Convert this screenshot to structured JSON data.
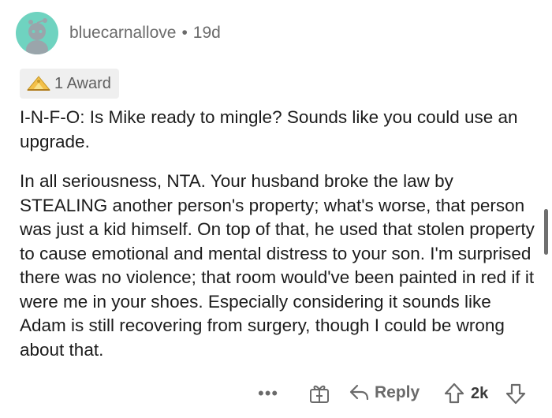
{
  "comment": {
    "username": "bluecarnallove",
    "separator": "•",
    "age": "19d",
    "award": {
      "label": "1 Award",
      "icon": "award-icon"
    },
    "paragraphs": [
      "I-N-F-O: Is Mike ready to mingle? Sounds like you could use an upgrade.",
      "In all seriousness, NTA. Your husband broke the law by STEALING another person's property; what's worse, that person was just a kid himself. On top of that, he used that stolen property to cause emotional and mental distress to your son. I'm surprised there was no violence; that room would've been painted in red if it were me in your shoes. Especially considering it sounds like Adam is still recovering from surgery, though I could be wrong about that."
    ]
  },
  "actions": {
    "more_label": "•••",
    "reply_label": "Reply",
    "score": "2k"
  },
  "colors": {
    "avatar_bg": "#6fd3c0",
    "meta_text": "#6b6b6b",
    "body_text": "#1c1c1c",
    "award_bg": "#efefef"
  }
}
